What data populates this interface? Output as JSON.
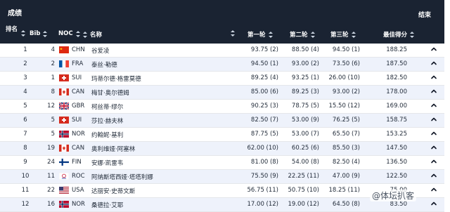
{
  "title": "成绩",
  "status": "结束",
  "columns": {
    "rank": "排名",
    "bib": "Bib",
    "noc": "NOC",
    "name": "名称",
    "run1": "第一轮",
    "run2": "第二轮",
    "run3": "第三轮",
    "best": "最佳得分"
  },
  "rows": [
    {
      "rank": "1",
      "bib": "4",
      "flag": "chn",
      "noc": "CHN",
      "name": "谷爱凌",
      "run1": "93.75 (2)",
      "run2": "88.50 (4)",
      "run3": "94.50 (1)",
      "best": "188.25"
    },
    {
      "rank": "2",
      "bib": "2",
      "flag": "fra",
      "noc": "FRA",
      "name": "泰丝·勒德",
      "run1": "94.50 (1)",
      "run2": "93.00 (2)",
      "run3": "73.50 (6)",
      "best": "187.50"
    },
    {
      "rank": "3",
      "bib": "1",
      "flag": "sui",
      "noc": "SUI",
      "name": "玛蒂尔德·格雷莫德",
      "run1": "89.25 (4)",
      "run2": "93.25 (1)",
      "run3": "26.00 (10)",
      "best": "182.50"
    },
    {
      "rank": "4",
      "bib": "8",
      "flag": "can",
      "noc": "CAN",
      "name": "梅甘·奥尔德姆",
      "run1": "85.00 (6)",
      "run2": "89.25 (3)",
      "run3": "93.00 (2)",
      "best": "178.00"
    },
    {
      "rank": "5",
      "bib": "12",
      "flag": "gbr",
      "noc": "GBR",
      "name": "柯丝蒂·缪尔",
      "run1": "90.25 (3)",
      "run2": "78.75 (5)",
      "run3": "15.50 (12)",
      "best": "169.00"
    },
    {
      "rank": "6",
      "bib": "5",
      "flag": "sui",
      "noc": "SUI",
      "name": "莎拉·赫夫林",
      "run1": "82.50 (7)",
      "run2": "53.00 (9)",
      "run3": "76.25 (5)",
      "best": "158.75"
    },
    {
      "rank": "7",
      "bib": "5",
      "flag": "nor",
      "noc": "NOR",
      "name": "约翰妮·基利",
      "run1": "87.75 (5)",
      "run2": "53.00 (7)",
      "run3": "65.50 (7)",
      "best": "153.25"
    },
    {
      "rank": "8",
      "bib": "19",
      "flag": "can",
      "noc": "CAN",
      "name": "奥利维娅·阿塞林",
      "run1": "62.00 (10)",
      "run2": "60.25 (6)",
      "run3": "85.50 (3)",
      "best": "147.50"
    },
    {
      "rank": "9",
      "bib": "24",
      "flag": "fin",
      "noc": "FIN",
      "name": "安娜·凯雷韦",
      "run1": "81.00 (8)",
      "run2": "54.00 (8)",
      "run3": "82.50 (4)",
      "best": "136.50"
    },
    {
      "rank": "10",
      "bib": "11",
      "flag": "roc",
      "noc": "ROC",
      "name": "阿纳斯塔西娅·塔塔利娜",
      "run1": "75.50 (9)",
      "run2": "22.25 (11)",
      "run3": "47.00 (9)",
      "best": "122.50"
    },
    {
      "rank": "11",
      "bib": "22",
      "flag": "usa",
      "noc": "USA",
      "name": "达丽安·史蒂文斯",
      "run1": "56.75 (11)",
      "run2": "50.75 (10)",
      "run3": "18.25 (11)",
      "best": "75.00"
    },
    {
      "rank": "12",
      "bib": "16",
      "flag": "nor",
      "noc": "NOR",
      "name": "桑德拉·艾耶",
      "run1": "17.00 (12)",
      "run2": "19.00 (12)",
      "run3": "64.50 (8)",
      "best": "83.50"
    }
  ],
  "watermark": "@体坛扒客",
  "icons": {
    "expand": "chevron-up-icon",
    "sort": "sort-icon"
  }
}
